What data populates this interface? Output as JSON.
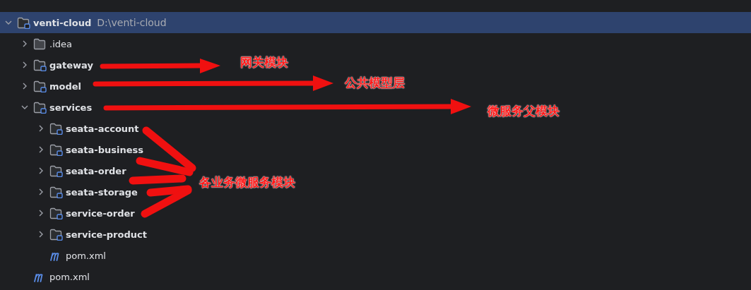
{
  "tree": {
    "name": "venti-cloud",
    "path": "D:\\venti-cloud",
    "kind": "module",
    "expanded": true,
    "selected": true,
    "children": [
      {
        "name": ".idea",
        "kind": "folder",
        "expanded": false,
        "selected": false
      },
      {
        "name": "gateway",
        "kind": "module",
        "expanded": false,
        "selected": false
      },
      {
        "name": "model",
        "kind": "module",
        "expanded": false,
        "selected": false
      },
      {
        "name": "services",
        "kind": "module",
        "expanded": true,
        "selected": false,
        "children": [
          {
            "name": "seata-account",
            "kind": "module",
            "expanded": false,
            "selected": false
          },
          {
            "name": "seata-business",
            "kind": "module",
            "expanded": false,
            "selected": false
          },
          {
            "name": "seata-order",
            "kind": "module",
            "expanded": false,
            "selected": false
          },
          {
            "name": "seata-storage",
            "kind": "module",
            "expanded": false,
            "selected": false
          },
          {
            "name": "service-order",
            "kind": "module",
            "expanded": false,
            "selected": false
          },
          {
            "name": "service-product",
            "kind": "module",
            "expanded": false,
            "selected": false
          },
          {
            "name": "pom.xml",
            "kind": "maven",
            "selected": false
          }
        ]
      },
      {
        "name": "pom.xml",
        "kind": "maven",
        "selected": false
      }
    ]
  },
  "annotations": [
    {
      "text": "网关模块"
    },
    {
      "text": "公共模型层"
    },
    {
      "text": "微服务父模块"
    },
    {
      "text": "各业务微服务模块"
    }
  ]
}
